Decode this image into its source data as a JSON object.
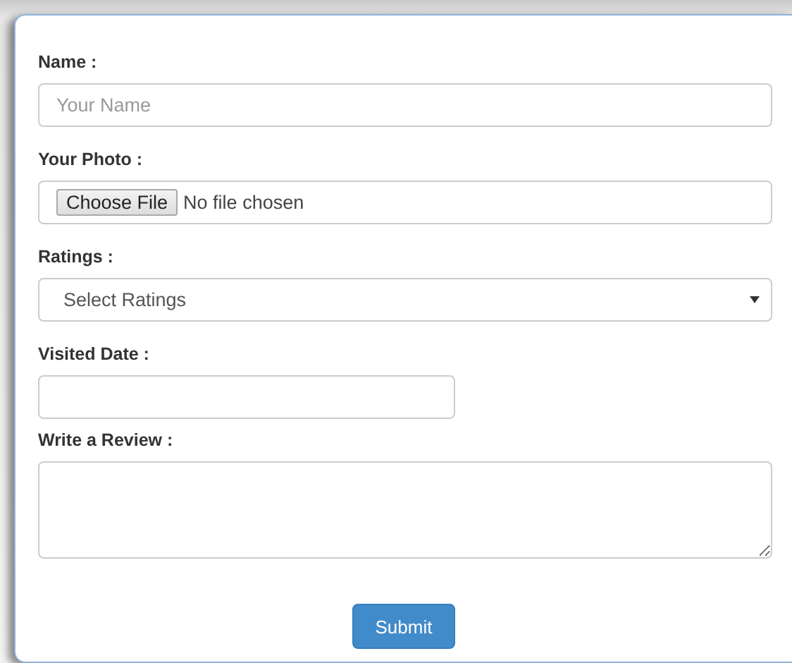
{
  "form": {
    "fields": [
      {
        "kind": "text",
        "label": "Name :",
        "placeholder": "Your Name"
      },
      {
        "kind": "file",
        "label": "Your Photo :",
        "button": "Choose File",
        "status": "No file chosen"
      },
      {
        "kind": "select",
        "label": "Ratings :",
        "value": "Select Ratings"
      },
      {
        "kind": "date",
        "label": "Visited Date :"
      },
      {
        "kind": "textarea",
        "label": "Write a Review :"
      }
    ],
    "submit": "Submit"
  }
}
